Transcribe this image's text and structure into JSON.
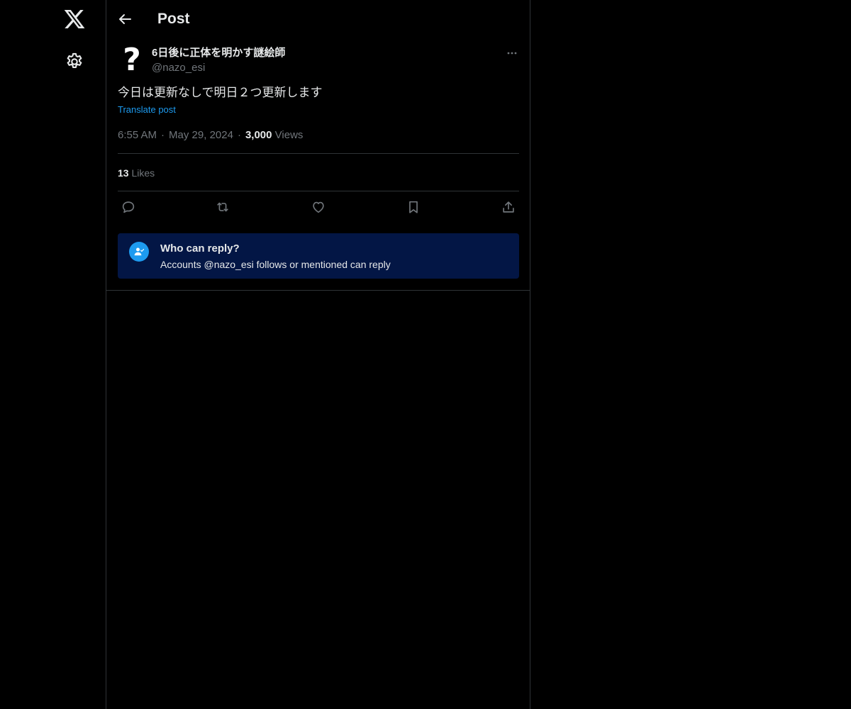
{
  "nav": {
    "logo_icon": "x-logo-icon",
    "settings_icon": "gear-icon"
  },
  "header": {
    "title": "Post",
    "back_icon": "arrow-left-icon"
  },
  "post": {
    "avatar_glyph": "?",
    "display_name": "6日後に正体を明かす謎絵師",
    "handle": "@nazo_esi",
    "text": "今日は更新なしで明日２つ更新します",
    "translate_label": "Translate post",
    "time": "6:55 AM",
    "date": "May 29, 2024",
    "views_count": "3,000",
    "views_label": "Views",
    "likes_count": "13",
    "likes_label": "Likes"
  },
  "actions": [
    {
      "name": "reply-icon"
    },
    {
      "name": "repost-icon"
    },
    {
      "name": "like-icon"
    },
    {
      "name": "bookmark-icon"
    },
    {
      "name": "share-icon"
    }
  ],
  "reply_restriction": {
    "title": "Who can reply?",
    "description": "Accounts @nazo_esi follows or mentioned can reply",
    "icon": "person-check-icon"
  },
  "colors": {
    "background": "#000000",
    "text": "#e7e9ea",
    "muted": "#71767b",
    "accent": "#1d9bf0",
    "border": "#2f3336",
    "reply_box": "#031645"
  }
}
